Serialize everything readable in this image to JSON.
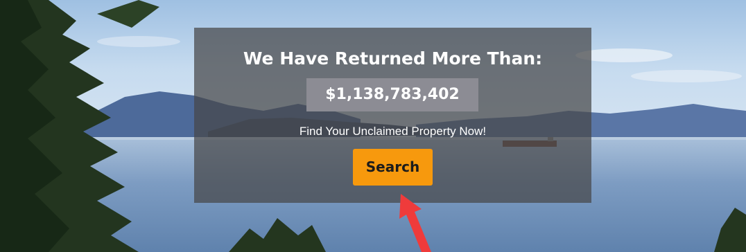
{
  "hero": {
    "headline": "We Have Returned More Than:",
    "amount": "$1,138,783,402",
    "tagline": "Find Your Unclaimed Property Now!",
    "search_label": "Search"
  },
  "colors": {
    "overlay": "#464648",
    "amount_box": "#8c8c94",
    "search_button": "#f7990d",
    "annotation_arrow": "#ef3b3b"
  },
  "icons": {
    "annotation": "red-arrow-icon"
  }
}
